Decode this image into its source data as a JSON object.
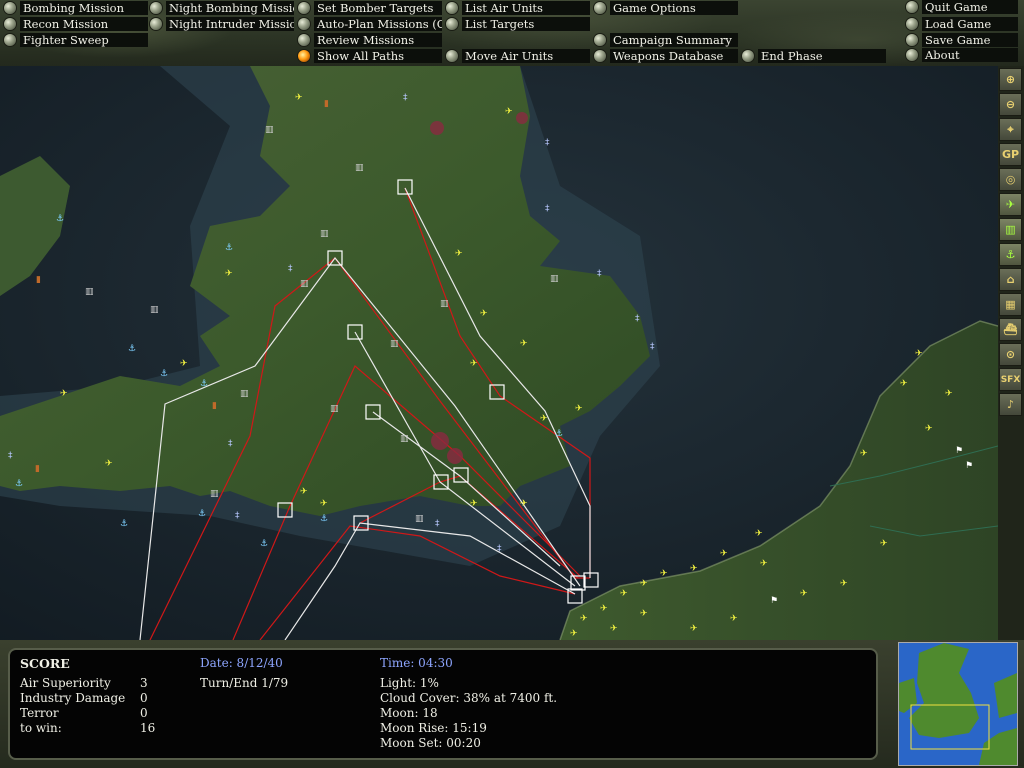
{
  "menu": {
    "col1": [
      "Bombing Mission",
      "Recon Mission",
      "Fighter Sweep"
    ],
    "col2": [
      "Night Bombing Mission",
      "Night Intruder Mission"
    ],
    "col3": [
      "Set Bomber Targets",
      "Auto-Plan Missions (Off)",
      "Review Missions",
      "Show All Paths"
    ],
    "col4": [
      "List Air Units",
      "List Targets",
      "Move Air Units"
    ],
    "col5": [
      "Game Options",
      "Campaign Summary",
      "Weapons Database"
    ],
    "end_phase": "End Phase",
    "col6": [
      "Quit Game",
      "Load Game",
      "Save Game",
      "About"
    ]
  },
  "tools": [
    {
      "icon": "zoom-in-icon",
      "glyph": "⊕"
    },
    {
      "icon": "zoom-out-icon",
      "glyph": "⊖"
    },
    {
      "icon": "center-crosshair-icon",
      "glyph": "⌖"
    },
    {
      "icon": "gp-icon",
      "glyph": "GP"
    },
    {
      "icon": "target-icon",
      "glyph": "◎"
    },
    {
      "icon": "aircraft-filter-icon",
      "glyph": "✈"
    },
    {
      "icon": "factory-filter-icon",
      "glyph": "▥"
    },
    {
      "icon": "anchor-filter-icon",
      "glyph": "⚓"
    },
    {
      "icon": "bridge-filter-icon",
      "glyph": "⌂"
    },
    {
      "icon": "government-building-icon",
      "glyph": "▦"
    },
    {
      "icon": "ship-filter-icon",
      "glyph": "⛴"
    },
    {
      "icon": "radar-icon",
      "glyph": "⊙"
    },
    {
      "icon": "sfx-toggle-icon",
      "glyph": "SFX"
    },
    {
      "icon": "music-toggle-icon",
      "glyph": "♪"
    }
  ],
  "score": {
    "heading": "SCORE",
    "rows": [
      {
        "label": "Air Superiority",
        "value": "3"
      },
      {
        "label": "Industry Damage",
        "value": "0"
      },
      {
        "label": "Terror",
        "value": "0"
      },
      {
        "label": "to win:",
        "value": "16"
      }
    ],
    "date_label": "Date: 8/12/40",
    "turn": "Turn/End 1/79",
    "time_label": "Time: 04:30",
    "conditions": [
      "Light: 1%",
      "Cloud Cover: 38% at 7400 ft.",
      "Moon: 18",
      "Moon Rise: 15:19",
      "Moon Set: 00:20"
    ]
  },
  "colors": {
    "sea": "#1d2a33",
    "land": "#3d5a2d",
    "red_path": "#d01818",
    "white_path": "#e8e8e8",
    "allied_unit": "#f0f040",
    "label_box": "#0c0f0b"
  }
}
